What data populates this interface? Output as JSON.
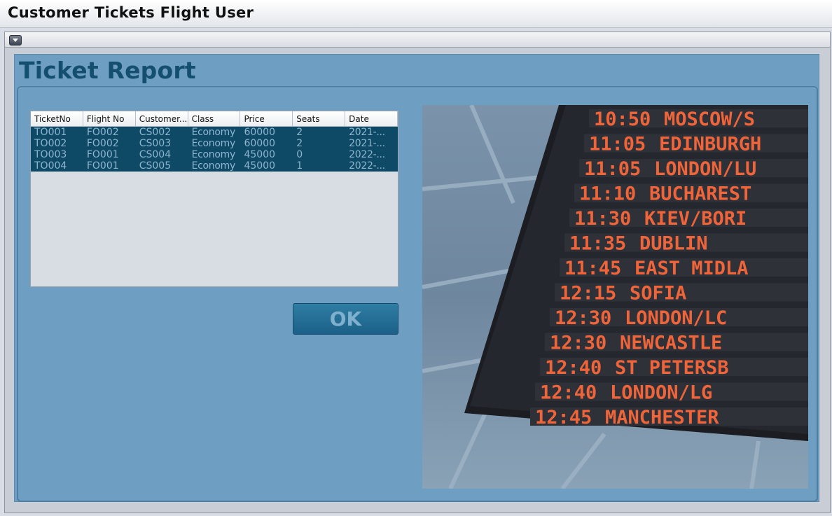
{
  "window": {
    "title": "Customer Tickets Flight User"
  },
  "frame": {
    "menu_icon": "chevron-down-icon"
  },
  "page": {
    "heading": "Ticket Report"
  },
  "table": {
    "columns": [
      "TicketNo",
      "Flight No",
      "Customer...",
      "Class",
      "Price",
      "Seats",
      "Date"
    ],
    "rows": [
      [
        "TO001",
        "FO002",
        "CS002",
        "Economy",
        "60000",
        "2",
        "2021-..."
      ],
      [
        "TO002",
        "FO002",
        "CS003",
        "Economy",
        "60000",
        "2",
        "2021-..."
      ],
      [
        "TO003",
        "FO001",
        "CS004",
        "Economy",
        "45000",
        "0",
        "2022-..."
      ],
      [
        "TO004",
        "FO001",
        "CS005",
        "Economy",
        "45000",
        "1",
        "2022-..."
      ]
    ]
  },
  "actions": {
    "ok_label": "OK"
  },
  "board_image": {
    "times": [
      "10:50",
      "11:05",
      "11:05",
      "11:10",
      "11:30",
      "11:35",
      "11:45",
      "12:15",
      "12:30",
      "12:30",
      "12:40",
      "12:40",
      "12:45"
    ],
    "destinations": [
      "MOSCOW/S",
      "EDINBURGH",
      "LONDON/LU",
      "BUCHAREST",
      "KIEV/BORI",
      "DUBLIN",
      "EAST MIDLA",
      "SOFIA",
      "LONDON/LC",
      "NEWCASTLE",
      "ST PETERSB",
      "LONDON/LG",
      "MANCHESTER"
    ]
  }
}
